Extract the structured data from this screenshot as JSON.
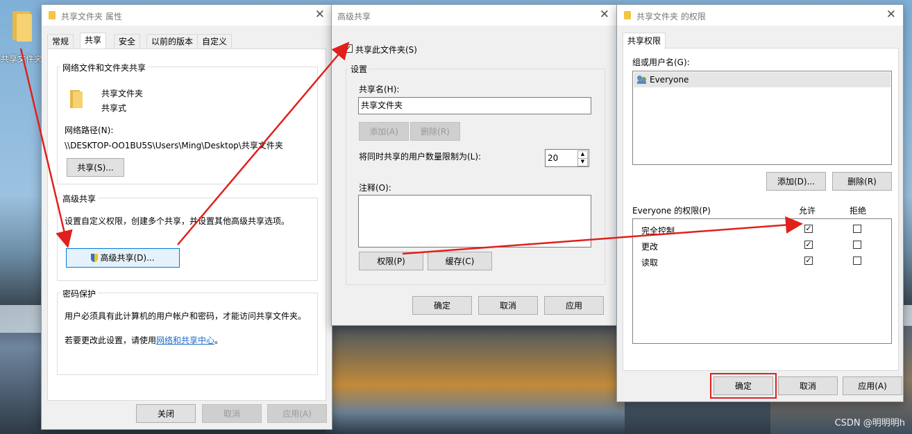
{
  "desktop": {
    "icon_label": "共享文件夹",
    "watermark": "CSDN @明明明h"
  },
  "props": {
    "title": "共享文件夹 属性",
    "tabs": [
      "常规",
      "共享",
      "安全",
      "以前的版本",
      "自定义"
    ],
    "net_group": "网络文件和文件夹共享",
    "folder_name": "共享文件夹",
    "folder_state": "共享式",
    "path_label": "网络路径(N):",
    "path_value": "\\\\DESKTOP-OO1BU5S\\Users\\Ming\\Desktop\\共享文件夹",
    "share_btn": "共享(S)...",
    "adv_group": "高级共享",
    "adv_desc": "设置自定义权限，创建多个共享，并设置其他高级共享选项。",
    "adv_btn": "高级共享(D)...",
    "pwd_group": "密码保护",
    "pwd_line1": "用户必须具有此计算机的用户帐户和密码，才能访问共享文件夹。",
    "pwd_line2_prefix": "若要更改此设置，请使用",
    "pwd_link": "网络和共享中心",
    "pwd_line2_suffix": "。",
    "close_btn": "关闭",
    "cancel_btn": "取消",
    "apply_btn": "应用(A)"
  },
  "adv": {
    "title": "高级共享",
    "share_check_label": "共享此文件夹(S)",
    "settings_group": "设置",
    "share_name_label": "共享名(H):",
    "share_name_value": "共享文件夹",
    "add_btn": "添加(A)",
    "remove_btn": "删除(R)",
    "limit_label": "将同时共享的用户数量限制为(L):",
    "limit_value": "20",
    "comment_label": "注释(O):",
    "perm_btn": "权限(P)",
    "cache_btn": "缓存(C)",
    "ok_btn": "确定",
    "cancel_btn": "取消",
    "apply_btn": "应用"
  },
  "perm": {
    "title": "共享文件夹 的权限",
    "tab": "共享权限",
    "users_label": "组或用户名(G):",
    "users": [
      "Everyone"
    ],
    "add_btn": "添加(D)...",
    "remove_btn": "删除(R)",
    "perm_label": "Everyone 的权限(P)",
    "allow_col": "允许",
    "deny_col": "拒绝",
    "rows": [
      {
        "name": "完全控制",
        "allow": true,
        "deny": false
      },
      {
        "name": "更改",
        "allow": true,
        "deny": false
      },
      {
        "name": "读取",
        "allow": true,
        "deny": false
      }
    ],
    "ok_btn": "确定",
    "cancel_btn": "取消",
    "apply_btn": "应用(A)"
  }
}
